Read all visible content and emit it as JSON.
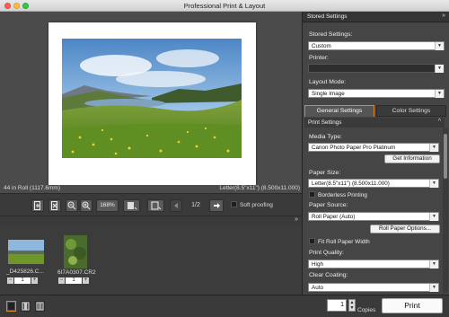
{
  "window": {
    "title": "Professional Print & Layout"
  },
  "preview": {
    "paper_info_left": "44 in Roll (1117.6mm)",
    "paper_info_right": "Letter(8.5\"x11\") (8.500x11.000)"
  },
  "toolbar": {
    "zoom_value": "168%",
    "page_indicator": "1/2",
    "soft_proofing_label": "Soft proofing"
  },
  "thumbnails": [
    {
      "filename": "_D425826.C...",
      "copies": "1"
    },
    {
      "filename": "6I7A0307.CR2",
      "copies": "1"
    }
  ],
  "right_panel": {
    "header": "Stored Settings",
    "stored_settings_label": "Stored Settings:",
    "stored_settings_value": "Custom",
    "printer_label": "Printer:",
    "printer_value": "",
    "layout_mode_label": "Layout Mode:",
    "layout_mode_value": "Single Image",
    "tabs": [
      "General Settings",
      "Color Settings"
    ],
    "print_settings_header": "Print Settings",
    "media_type_label": "Media Type:",
    "media_type_value": "Canon Photo Paper Pro Platinum",
    "get_information_button": "Get Information",
    "paper_size_label": "Paper Size:",
    "paper_size_value": "Letter(8.5\"x11\") (8.500x11.000)",
    "borderless_label": "Borderless Printing",
    "paper_source_label": "Paper Source:",
    "paper_source_value": "Roll Paper (Auto)",
    "roll_paper_options_button": "Roll Paper Options...",
    "fit_roll_label": "Fit Roll Paper Width",
    "print_quality_label": "Print Quality:",
    "print_quality_value": "High",
    "clear_coating_label": "Clear Coating:",
    "clear_coating_value": "Auto"
  },
  "bottom": {
    "copies_value": "1",
    "copies_label": "Copies",
    "print_button": "Print"
  },
  "colors": {
    "accent": "#e08a1e",
    "panel": "#454545",
    "background": "#3c3c3c"
  }
}
